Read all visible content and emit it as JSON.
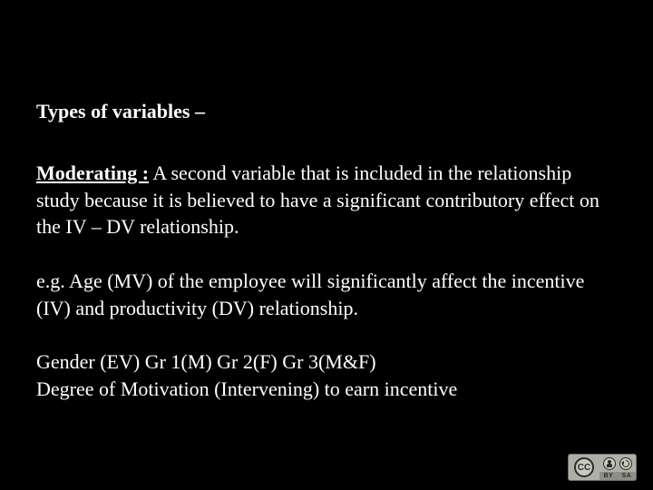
{
  "heading": "Types of variables –",
  "moderating": {
    "lead": "Moderating :",
    "definition": " A second  variable that is included in the relationship study because it is believed to have a significant contributory effect on the IV – DV relationship."
  },
  "example": "e.g. Age (MV) of the employee will significantly affect the incentive (IV) and productivity (DV) relationship.",
  "extra_line1": "Gender (EV) Gr 1(M) Gr 2(F) Gr 3(M&F)",
  "extra_line2": "Degree of Motivation (Intervening) to earn incentive",
  "cc": {
    "cc_text": "CC",
    "by": "BY",
    "sa": "SA"
  }
}
